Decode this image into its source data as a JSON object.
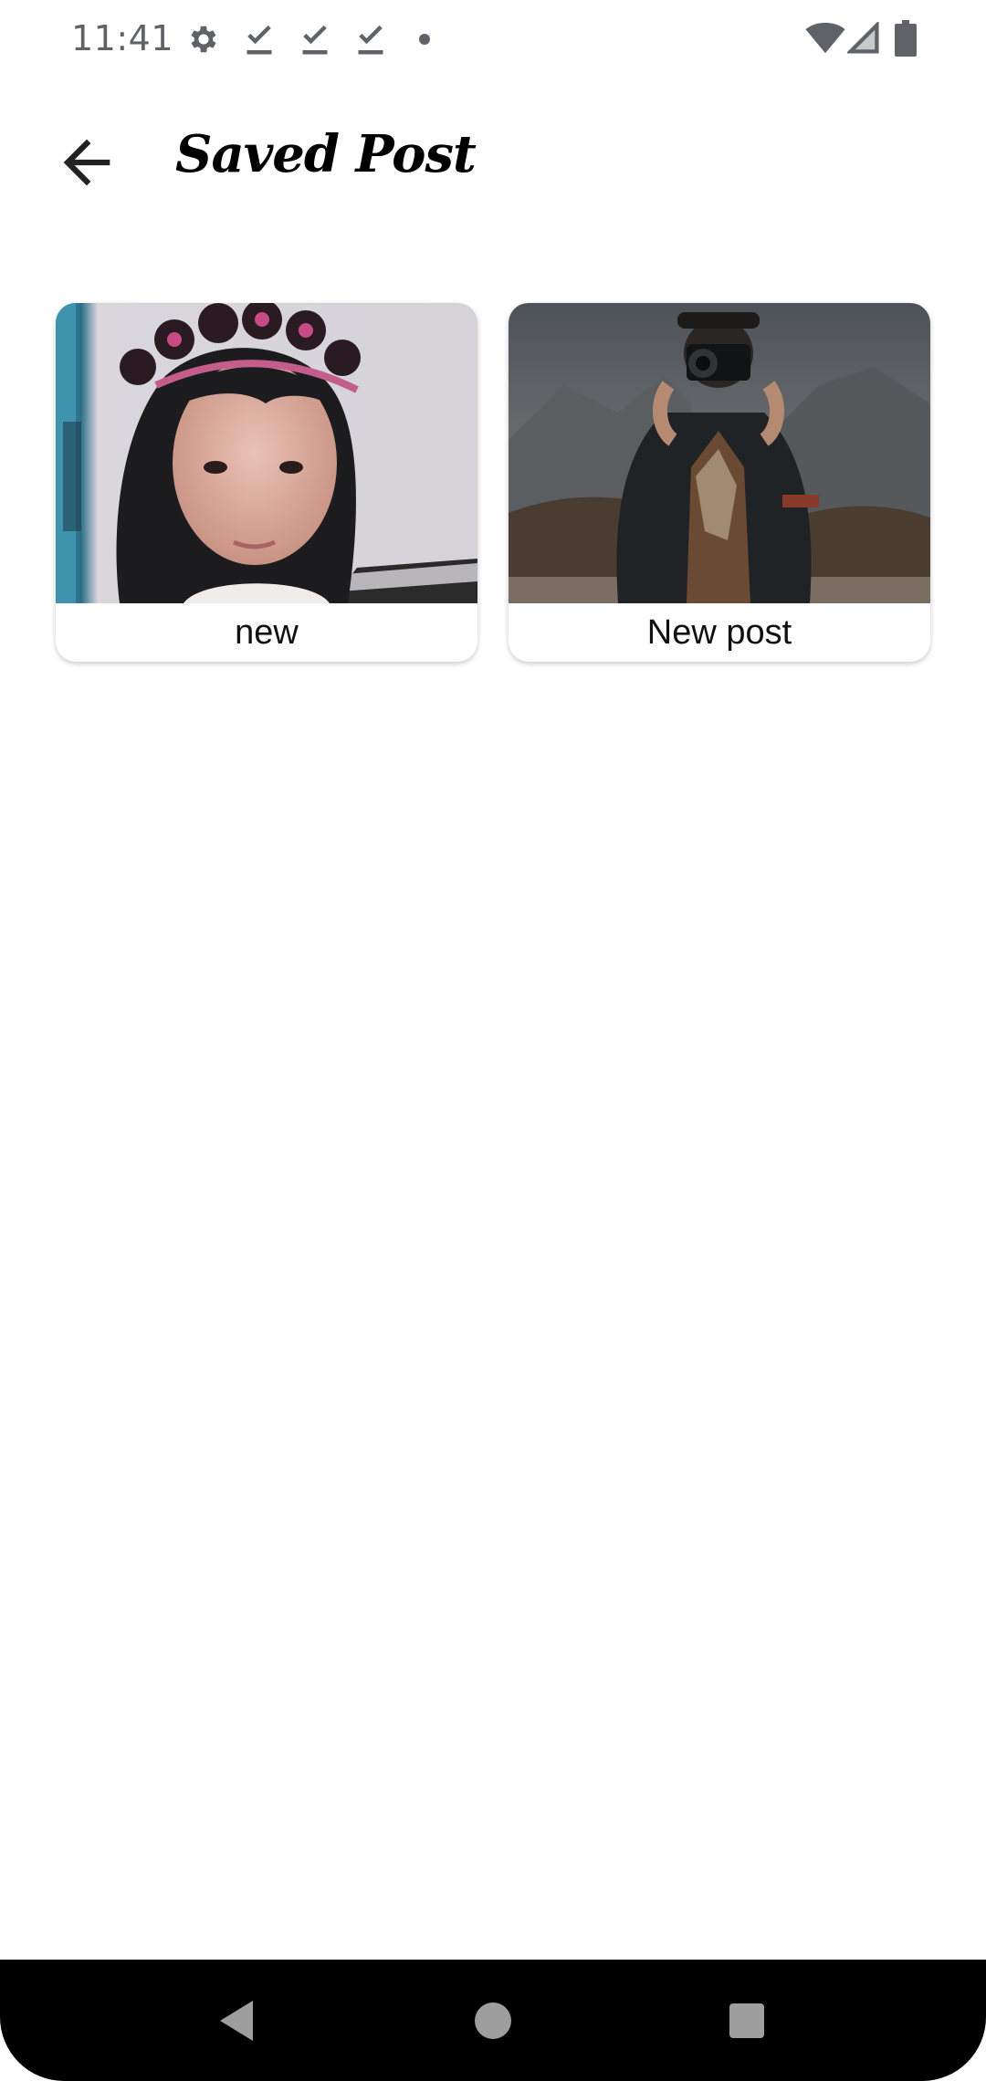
{
  "status_bar": {
    "time": "11:41",
    "icons": [
      "settings-icon",
      "download-done-icon",
      "download-done-icon",
      "download-done-icon",
      "notification-dot-icon"
    ],
    "right_icons": [
      "wifi-icon",
      "cell-signal-icon",
      "battery-icon"
    ]
  },
  "app_bar": {
    "back_icon": "arrow-back-icon",
    "title": "Saved Post"
  },
  "posts": [
    {
      "label": "new",
      "image": "photo-girl-with-headband"
    },
    {
      "label": "New post",
      "image": "photo-photographer-with-camera"
    }
  ],
  "nav_bar": {
    "icons": [
      "back-triangle-icon",
      "home-circle-icon",
      "recents-square-icon"
    ]
  },
  "colors": {
    "background": "#ffffff",
    "status_text": "#5f6368",
    "nav_bar": "#000000",
    "nav_icons": "#9e9e9e"
  }
}
